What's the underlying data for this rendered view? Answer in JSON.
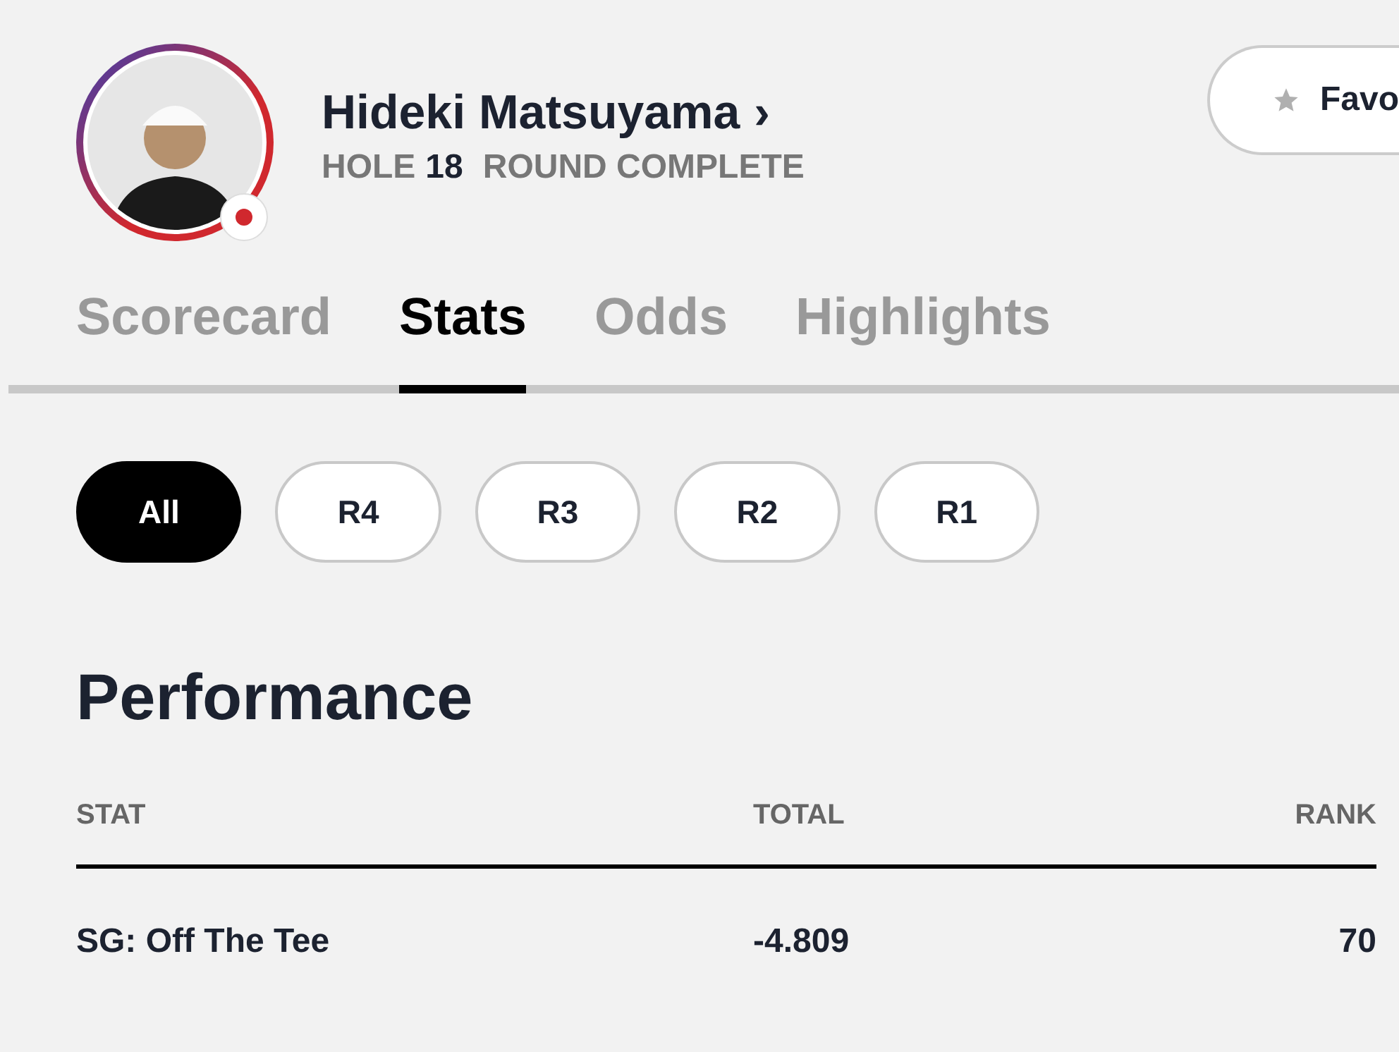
{
  "player": {
    "name": "Hideki Matsuyama",
    "chevron": "›",
    "hole_label": "HOLE",
    "hole": "18",
    "status": "ROUND COMPLETE"
  },
  "favorite_button": {
    "label": "Favo"
  },
  "tabs": [
    {
      "label": "Scorecard",
      "selected": false
    },
    {
      "label": "Stats",
      "selected": true
    },
    {
      "label": "Odds",
      "selected": false
    },
    {
      "label": "Highlights",
      "selected": false
    }
  ],
  "rounds": [
    {
      "label": "All",
      "selected": true
    },
    {
      "label": "R4",
      "selected": false
    },
    {
      "label": "R3",
      "selected": false
    },
    {
      "label": "R2",
      "selected": false
    },
    {
      "label": "R1",
      "selected": false
    }
  ],
  "performance": {
    "title": "Performance",
    "columns": [
      "STAT",
      "TOTAL",
      "RANK"
    ],
    "rows": [
      {
        "stat": "SG: Off The Tee",
        "total": "-4.809",
        "rank": "70"
      }
    ]
  }
}
